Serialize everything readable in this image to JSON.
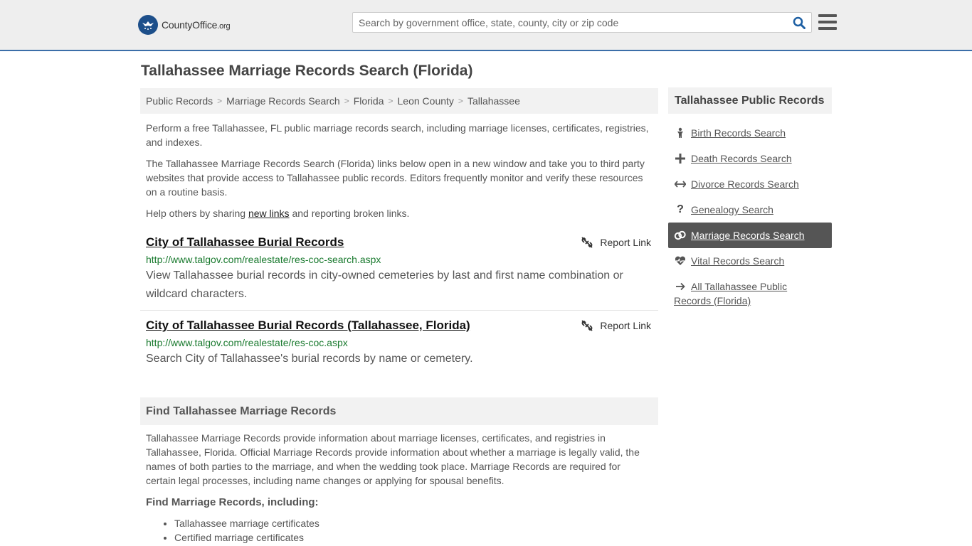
{
  "header": {
    "logo_text": "CountyOffice",
    "logo_suffix": ".org",
    "search_placeholder": "Search by government office, state, county, city or zip code"
  },
  "page_title": "Tallahassee Marriage Records Search (Florida)",
  "breadcrumb": [
    "Public Records",
    "Marriage Records Search",
    "Florida",
    "Leon County",
    "Tallahassee"
  ],
  "intro": {
    "p1": "Perform a free Tallahassee, FL public marriage records search, including marriage licenses, certificates, registries, and indexes.",
    "p2": "The Tallahassee Marriage Records Search (Florida) links below open in a new window and take you to third party websites that provide access to Tallahassee public records. Editors frequently monitor and verify these resources on a routine basis.",
    "p3_before": "Help others by sharing ",
    "p3_link": "new links",
    "p3_after": " and reporting broken links."
  },
  "results": [
    {
      "title": "City of Tallahassee Burial Records",
      "url": "http://www.talgov.com/realestate/res-coc-search.aspx",
      "description": "View Tallahassee burial records in city-owned cemeteries by last and first name combination or wildcard characters.",
      "report_label": "Report Link"
    },
    {
      "title": "City of Tallahassee Burial Records (Tallahassee, Florida)",
      "url": "http://www.talgov.com/realestate/res-coc.aspx",
      "description": "Search City of Tallahassee's burial records by name or cemetery.",
      "report_label": "Report Link"
    }
  ],
  "find_section": {
    "heading": "Find Tallahassee Marriage Records",
    "body": "Tallahassee Marriage Records provide information about marriage licenses, certificates, and registries in Tallahassee, Florida. Official Marriage Records provide information about whether a marriage is legally valid, the names of both parties to the marriage, and when the wedding took place. Marriage Records are required for certain legal processes, including name changes or applying for spousal benefits.",
    "subheading": "Find Marriage Records, including:",
    "bullets": [
      "Tallahassee marriage certificates",
      "Certified marriage certificates"
    ]
  },
  "sidebar": {
    "heading": "Tallahassee Public Records",
    "items": [
      {
        "label": "Birth Records Search",
        "icon": "baby-icon"
      },
      {
        "label": "Death Records Search",
        "icon": "cross-icon"
      },
      {
        "label": "Divorce Records Search",
        "icon": "arrows-split-icon"
      },
      {
        "label": "Genealogy Search",
        "icon": "question-icon"
      },
      {
        "label": "Marriage Records Search",
        "icon": "rings-icon",
        "active": true
      },
      {
        "label": "Vital Records Search",
        "icon": "heartbeat-icon"
      },
      {
        "label": "All Tallahassee Public Records (Florida)",
        "icon": "arrow-right-icon"
      }
    ]
  },
  "colors": {
    "accent_blue": "#1d4f8a",
    "url_green": "#1a7a2f",
    "active_bg": "#555555"
  }
}
